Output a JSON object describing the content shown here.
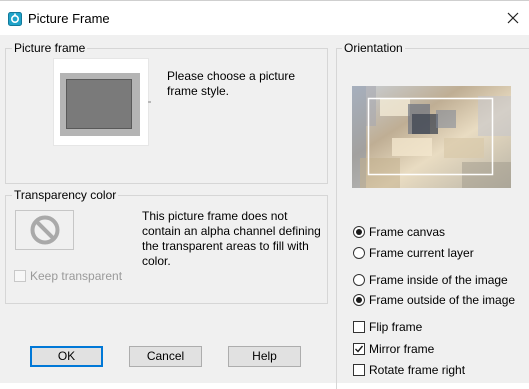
{
  "window": {
    "title": "Picture Frame"
  },
  "picture_frame": {
    "label": "Picture frame",
    "hint": "Please choose a picture frame style."
  },
  "transparency": {
    "label": "Transparency color",
    "message": "This picture frame does not contain an alpha channel defining the transparent areas to fill with color.",
    "keep_transparent": {
      "label": "Keep transparent",
      "checked": false,
      "enabled": false
    }
  },
  "orientation": {
    "label": "Orientation",
    "frame_target": [
      {
        "label": "Frame canvas",
        "selected": true
      },
      {
        "label": "Frame current layer",
        "selected": false
      }
    ],
    "frame_position": [
      {
        "label": "Frame inside of the image",
        "selected": false
      },
      {
        "label": "Frame outside of the image",
        "selected": true
      }
    ],
    "options": [
      {
        "label": "Flip frame",
        "checked": false
      },
      {
        "label": "Mirror frame",
        "checked": true
      },
      {
        "label": "Rotate frame right",
        "checked": false
      }
    ]
  },
  "buttons": {
    "ok": "OK",
    "cancel": "Cancel",
    "help": "Help"
  },
  "colors": {
    "accent": "#0078d7",
    "dialog_bg": "#f0f0f0"
  },
  "icons": {
    "app": "picture-frame-app-icon",
    "close": "close-icon",
    "no_color": "no-color-icon"
  }
}
